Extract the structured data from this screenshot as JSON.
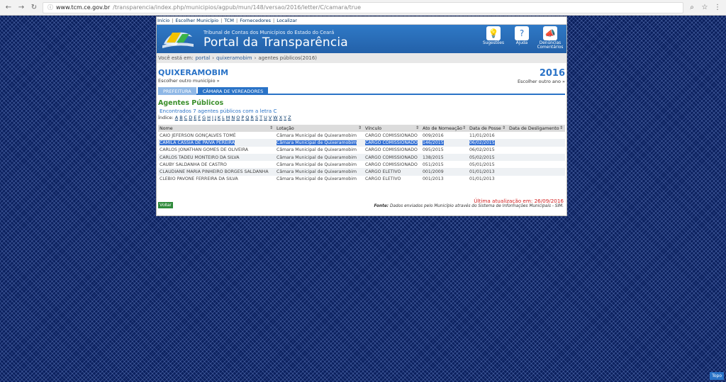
{
  "browser": {
    "url_host": "www.tcm.ce.gov.br",
    "url_path": "/transparencia/index.php/municipios/agpub/mun/148/versao/2016/letter/C/camara/true"
  },
  "topnav": [
    "Início",
    "Escolher Município",
    "TCM",
    "Fornecedores",
    "Localizar"
  ],
  "banner": {
    "subtitle": "Tribunal de Contas dos Municípios do Estado do Ceará",
    "title": "Portal da Transparência",
    "icons": [
      {
        "label": "Sugestões",
        "icon": "lightbulb-icon",
        "glyph": "💡"
      },
      {
        "label": "Ajuda",
        "icon": "help-icon",
        "glyph": "?"
      },
      {
        "label": "Denúncias Comentários",
        "icon": "megaphone-icon",
        "glyph": "📣"
      }
    ]
  },
  "breadcrumb": {
    "prefix": "Você está em:",
    "items": [
      "portal",
      "quixeramobim",
      "agentes públicos(2016)"
    ]
  },
  "municipality": {
    "name": "QUIXERAMOBIM",
    "change_link": "Escolher outro município »",
    "year": "2016",
    "change_year_link": "Escolher outro ano »"
  },
  "tabs": [
    {
      "label": "PREFEITURA",
      "active": false
    },
    {
      "label": "CÂMARA DE VEREADORES",
      "active": true
    }
  ],
  "section": {
    "title": "Agentes Públicos",
    "found": "Encontrados 7 agentes públicos com a letra C",
    "index_label": "Índice:",
    "letters": [
      "A",
      "B",
      "C",
      "D",
      "E",
      "F",
      "G",
      "H",
      "I",
      "J",
      "K",
      "L",
      "M",
      "N",
      "O",
      "P",
      "Q",
      "R",
      "S",
      "T",
      "U",
      "V",
      "W",
      "X",
      "Y",
      "Z"
    ]
  },
  "table": {
    "headers": [
      "Nome",
      "Lotação",
      "Vínculo",
      "Ato de Nomeação",
      "Data de Posse",
      "Data de Desligamento"
    ],
    "rows": [
      [
        "CAIO JEFERSON GONÇALVES TOMÉ",
        "Câmara Municipal de Quixeramobim",
        "CARGO COMISSIONADO",
        "009/2016",
        "11/01/2016",
        ""
      ],
      [
        "CAMILA CASSIA DE PAIVA PEREIRA",
        "Câmara Municipal de Quixeramobim",
        "CARGO COMISSIONADO",
        "146/2015",
        "06/02/2015",
        ""
      ],
      [
        "CARLOS JONATHAN GOMES DE OLIVEIRA",
        "Câmara Municipal de Quixeramobim",
        "CARGO COMISSIONADO",
        "095/2015",
        "06/02/2015",
        ""
      ],
      [
        "CARLOS TADEU MONTEIRO DA SILVA",
        "Câmara Municipal de Quixeramobim",
        "CARGO COMISSIONADO",
        "138/2015",
        "05/02/2015",
        ""
      ],
      [
        "CAUBY SALDANHA DE CASTRO",
        "Câmara Municipal de Quixeramobim",
        "CARGO COMISSIONADO",
        "051/2015",
        "05/01/2015",
        ""
      ],
      [
        "CLAUDIANE MARIA PINHEIRO BORGES SALDANHA",
        "Câmara Municipal de Quixeramobim",
        "CARGO ELETIVO",
        "001/2009",
        "01/01/2013",
        ""
      ],
      [
        "CLEBIO PAVONE FERREIRA DA SILVA",
        "Câmara Municipal de Quixeramobim",
        "CARGO ELETIVO",
        "001/2013",
        "01/01/2013",
        ""
      ]
    ],
    "selected_row": 1
  },
  "footer": {
    "updated": "Última atualização em: 26/09/2016",
    "source_label": "Fonte:",
    "source_text": "Dados enviados pelo Município através do Sistema de Informações Municipais - SIM.",
    "back_label": "Voltar"
  },
  "topo_label": "Topo",
  "colors": {
    "accent": "#2a73c7",
    "banner": "#2f79c6",
    "section_green": "#3b8f2b",
    "update_red": "#d42020",
    "selection": "#3370d4"
  }
}
